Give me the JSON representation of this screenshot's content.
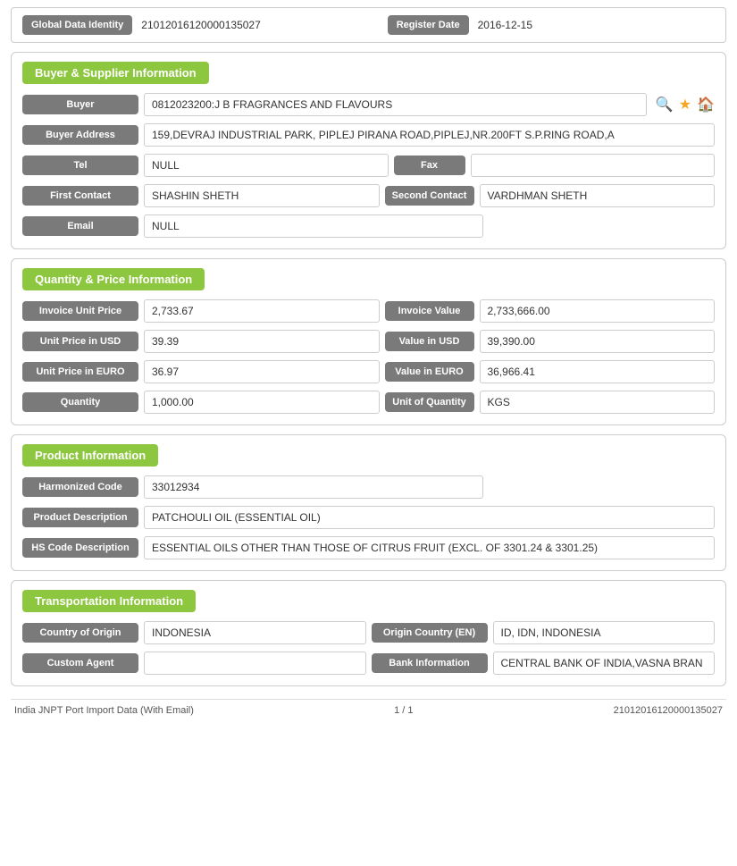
{
  "topBar": {
    "globalDataIdentityLabel": "Global Data Identity",
    "globalDataIdentityValue": "21012016120000135027",
    "registerDateLabel": "Register Date",
    "registerDateValue": "2016-12-15"
  },
  "buyerSupplier": {
    "sectionTitle": "Buyer & Supplier Information",
    "fields": {
      "buyerLabel": "Buyer",
      "buyerValue": "0812023200:J B FRAGRANCES AND FLAVOURS",
      "buyerAddressLabel": "Buyer Address",
      "buyerAddressValue": "159,DEVRAJ INDUSTRIAL PARK, PIPLEJ PIRANA ROAD,PIPLEJ,NR.200FT S.P.RING ROAD,A",
      "telLabel": "Tel",
      "telValue": "NULL",
      "faxLabel": "Fax",
      "faxValue": "",
      "firstContactLabel": "First Contact",
      "firstContactValue": "SHASHIN SHETH",
      "secondContactLabel": "Second Contact",
      "secondContactValue": "VARDHMAN SHETH",
      "emailLabel": "Email",
      "emailValue": "NULL"
    }
  },
  "quantityPrice": {
    "sectionTitle": "Quantity & Price Information",
    "fields": {
      "invoiceUnitPriceLabel": "Invoice Unit Price",
      "invoiceUnitPriceValue": "2,733.67",
      "invoiceValueLabel": "Invoice Value",
      "invoiceValueValue": "2,733,666.00",
      "unitPriceUSDLabel": "Unit Price in USD",
      "unitPriceUSDValue": "39.39",
      "valueUSDLabel": "Value in USD",
      "valueUSDValue": "39,390.00",
      "unitPriceEUROLabel": "Unit Price in EURO",
      "unitPriceEUROValue": "36.97",
      "valueEUROLabel": "Value in EURO",
      "valueEUROValue": "36,966.41",
      "quantityLabel": "Quantity",
      "quantityValue": "1,000.00",
      "unitOfQuantityLabel": "Unit of Quantity",
      "unitOfQuantityValue": "KGS"
    }
  },
  "productInfo": {
    "sectionTitle": "Product Information",
    "fields": {
      "harmonizedCodeLabel": "Harmonized Code",
      "harmonizedCodeValue": "33012934",
      "productDescriptionLabel": "Product Description",
      "productDescriptionValue": "PATCHOULI OIL (ESSENTIAL OIL)",
      "hsCodeDescLabel": "HS Code Description",
      "hsCodeDescValue": "ESSENTIAL OILS OTHER THAN THOSE OF CITRUS FRUIT (EXCL. OF 3301.24 & 3301.25)"
    }
  },
  "transportInfo": {
    "sectionTitle": "Transportation Information",
    "fields": {
      "countryOfOriginLabel": "Country of Origin",
      "countryOfOriginValue": "INDONESIA",
      "originCountryENLabel": "Origin Country (EN)",
      "originCountryENValue": "ID, IDN, INDONESIA",
      "customAgentLabel": "Custom Agent",
      "customAgentValue": "",
      "bankInfoLabel": "Bank Information",
      "bankInfoValue": "CENTRAL BANK OF INDIA,VASNA BRAN"
    }
  },
  "footer": {
    "left": "India JNPT Port Import Data (With Email)",
    "center": "1 / 1",
    "right": "21012016120000135027"
  },
  "icons": {
    "search": "🔍",
    "star": "★",
    "home": "🏠"
  }
}
